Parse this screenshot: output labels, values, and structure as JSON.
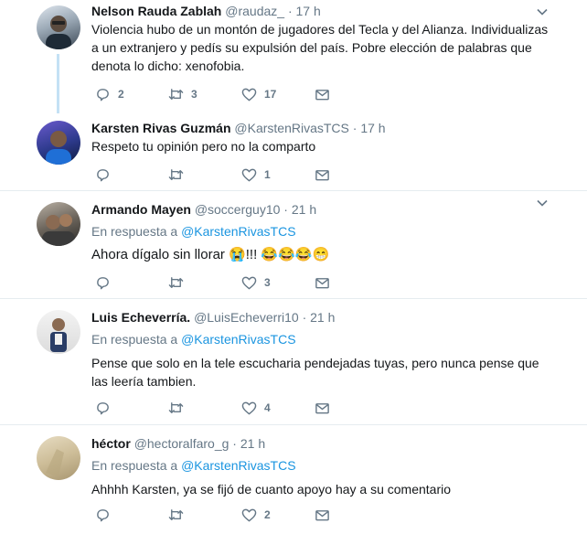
{
  "tweets": [
    {
      "fullname": "Nelson Rauda Zablah",
      "handle": "@raudaz_",
      "time": "17 h",
      "reply_prefix": "",
      "reply_mention": "",
      "text_lines": [
        "Violencia hubo de un montón de jugadores del Tecla y del Alianza. Individualizas",
        "a un extranjero y pedís su expulsión del país. Pobre elección de palabras que",
        "denota lo dicho: xenofobia."
      ],
      "replies": "2",
      "retweets": "3",
      "likes": "17"
    },
    {
      "fullname": "Karsten Rivas Guzmán",
      "handle": "@KarstenRivasTCS",
      "time": "17 h",
      "reply_prefix": "",
      "reply_mention": "",
      "text_lines": [
        "Respeto tu opinión pero no la comparto"
      ],
      "replies": "",
      "retweets": "",
      "likes": "1"
    },
    {
      "fullname": "Armando Mayen",
      "handle": "@soccerguy10",
      "time": "21 h",
      "reply_prefix": "En respuesta a",
      "reply_mention": "@KarstenRivasTCS",
      "text_lines": [
        "Ahora dígalo sin llorar 😭!!! 😂😂😂😁"
      ],
      "replies": "",
      "retweets": "",
      "likes": "3"
    },
    {
      "fullname": "Luis Echeverría.",
      "handle": "@LuisEcheverri10",
      "time": "21 h",
      "reply_prefix": "En respuesta a",
      "reply_mention": "@KarstenRivasTCS",
      "text_lines": [
        "Pense que solo en la tele escucharia pendejadas tuyas, pero nunca pense que",
        "las leería tambien."
      ],
      "replies": "",
      "retweets": "",
      "likes": "4"
    },
    {
      "fullname": "héctor",
      "handle": "@hectoralfaro_g",
      "time": "21 h",
      "reply_prefix": "En respuesta a",
      "reply_mention": "@KarstenRivasTCS",
      "text_lines": [
        "Ahhhh Karsten, ya se fijó de cuanto apoyo hay a su comentario"
      ],
      "replies": "",
      "retweets": "",
      "likes": "2"
    }
  ],
  "colors": {
    "link": "#1b95e0",
    "secondary": "#657786",
    "border": "#e6ecf0",
    "thread_line": "#c4e1f5"
  }
}
